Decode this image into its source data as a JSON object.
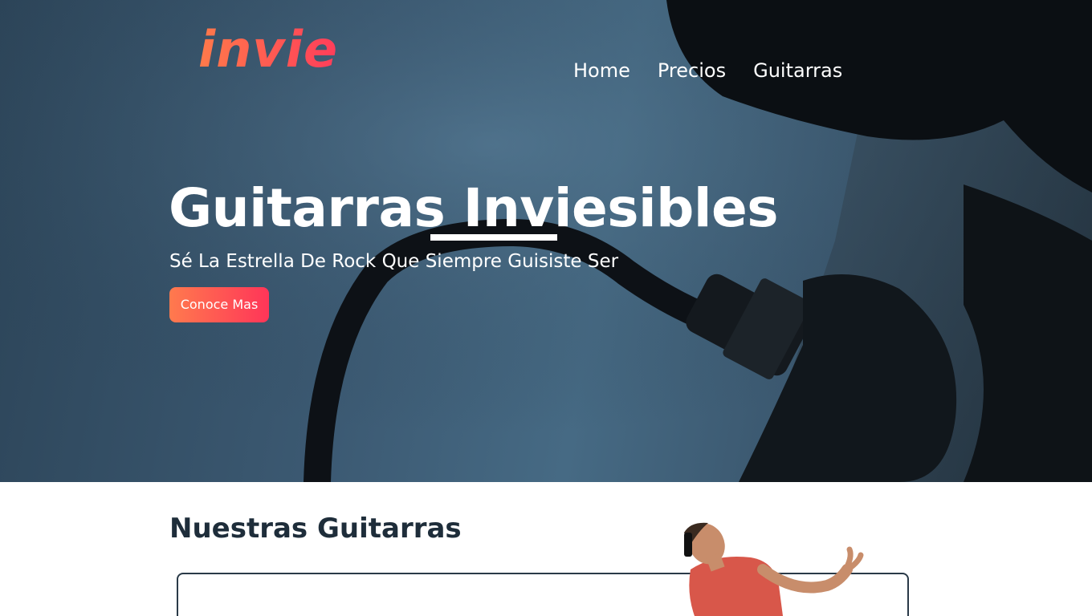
{
  "brand": {
    "logo_text": "invie",
    "accent_color": "#ff4a4a"
  },
  "nav": {
    "items": [
      "Home",
      "Precios",
      "Guitarras"
    ]
  },
  "hero": {
    "title": "Guitarras Inviesibles",
    "subtitle": "Sé La Estrella De Rock Que Siempre Guisiste Ser",
    "cta_label": "Conoce Mas"
  },
  "section": {
    "title": "Nuestras Guitarras"
  }
}
